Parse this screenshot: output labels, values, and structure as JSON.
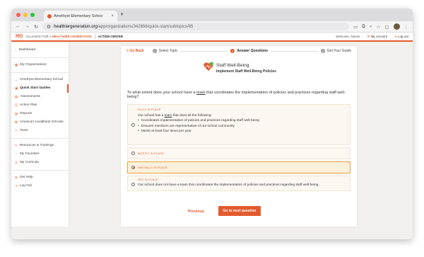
{
  "browser": {
    "tab_title": "Amethyst Elementary Schoo",
    "url_host": "healthiergeneration.org",
    "url_path": "/app/organizations/342656/quick-start/subtopics/65"
  },
  "header": {
    "logo_mark": "HG",
    "brand_prefix": "ALLIANCE FOR A ",
    "brand_highlight": "HEALTHIER GENERATION",
    "section": "ACTION CENTER",
    "welcome": "Welcome, Naomi",
    "my_account": "My Account",
    "logout": "Log out"
  },
  "sidebar": {
    "items": [
      {
        "label": "Dashboard"
      },
      {
        "label": "My Organizations"
      },
      {
        "label": "Amethyst Elementary School"
      },
      {
        "label": "Quick Start Guides"
      },
      {
        "label": "Assessments"
      },
      {
        "label": "Action Plan"
      },
      {
        "label": "Reports"
      },
      {
        "label": "America's Healthiest Schools"
      },
      {
        "label": "Team"
      },
      {
        "label": "Resources & Trainings"
      },
      {
        "label": "My Favorites"
      },
      {
        "label": "My Curricula"
      },
      {
        "label": "Get Help"
      },
      {
        "label": "Log Out"
      }
    ]
  },
  "steps": {
    "go_back": "< Go Back",
    "items": [
      {
        "num": "1",
        "label": "Select Topic"
      },
      {
        "num": "2",
        "label": "Answer Questions"
      },
      {
        "num": "3",
        "label": "Get Your Guide"
      }
    ]
  },
  "topic": {
    "title": "Staff Well-Being",
    "subtitle": "Implement Staff Well-Being Policies"
  },
  "question": {
    "pre": "To what extent does your school have a ",
    "link": "team",
    "post": " that coordinates the implementation of policies and practices regarding staff well-being?"
  },
  "options": [
    {
      "label": "FULLY IN PLACE",
      "intro_pre": "Our school has a ",
      "intro_link": "team",
      "intro_post": " that does all the following:",
      "bullets": [
        "Coordinates implementation of policies and practices regarding staff well-being",
        "Ensures members are representative of our school community",
        "Meets at least four times per year"
      ]
    },
    {
      "label": "MOSTLY IN PLACE"
    },
    {
      "label": "PARTIALLY IN PLACE"
    },
    {
      "label": "NOT IN PLACE",
      "text": "Our school does not have a team that coordinates the implementation of policies and practices regarding staff well-being."
    }
  ],
  "footer": {
    "previous": "Previous",
    "next": "Go to next question"
  },
  "colors": {
    "accent": "#e35a2e",
    "selected_border": "#e8a33a"
  }
}
